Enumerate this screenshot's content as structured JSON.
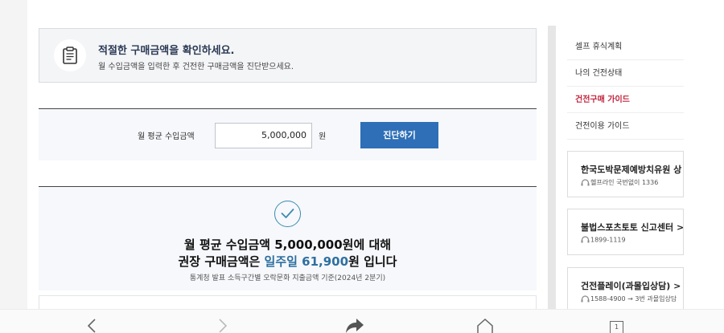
{
  "notice": {
    "title": "적절한 구매금액을 확인하세요.",
    "description": "월 수입금액을 입력한 후 건전한 구매금액을 진단받으세요.",
    "icon": "clipboard-icon"
  },
  "form": {
    "label": "월 평균 수입금액",
    "income_value": "5,000,000",
    "unit": "원",
    "button_label": "진단하기"
  },
  "result": {
    "icon": "check-circle-icon",
    "line1": "월 평균 수입금액 5,000,000원에 대해",
    "line2_prefix": "권장 구매금액은 ",
    "line2_highlight": "일주일 61,900",
    "line2_suffix": "원 입니다",
    "source": "통계청 발표 소득구간별 오락문화 지출금액 기준(2024년 2분기)"
  },
  "sidebar": {
    "menu": [
      {
        "label": "셀프 휴식계획",
        "active": false
      },
      {
        "label": "나의 건전상태",
        "active": false
      },
      {
        "label": "건전구매 가이드",
        "active": true
      },
      {
        "label": "건전이용 가이드",
        "active": false
      }
    ],
    "cards": [
      {
        "title": "한국도박문제예방치유원 상",
        "phone": "헬프라인 국번없이 1336"
      },
      {
        "title": "불법스포츠토토 신고센터 >",
        "phone": "1899-1119"
      },
      {
        "title": "건전플레이(과몰입상담) >",
        "phone": "1588-4900 → 3번 과몰입상담"
      }
    ]
  },
  "toolbar": {
    "tab_count": "1"
  },
  "colors": {
    "accent_blue": "#2e6fb7",
    "active_red": "#c0223b",
    "highlight_blue": "#2e6fa0"
  }
}
